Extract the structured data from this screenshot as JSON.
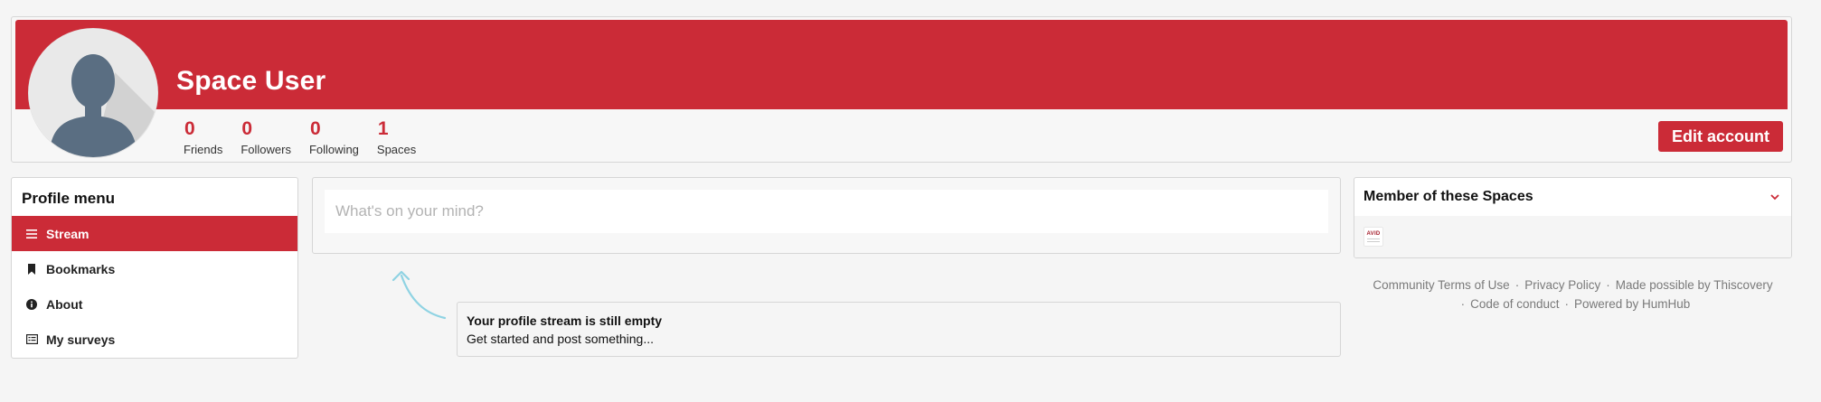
{
  "profile": {
    "name": "Space User",
    "stats": [
      {
        "value": "0",
        "label": "Friends"
      },
      {
        "value": "0",
        "label": "Followers"
      },
      {
        "value": "0",
        "label": "Following"
      },
      {
        "value": "1",
        "label": "Spaces"
      }
    ],
    "edit_label": "Edit account"
  },
  "menu": {
    "title": "Profile menu",
    "items": [
      {
        "label": "Stream",
        "icon": "list-icon",
        "active": true
      },
      {
        "label": "Bookmarks",
        "icon": "bookmark-icon",
        "active": false
      },
      {
        "label": "About",
        "icon": "info-icon",
        "active": false
      },
      {
        "label": "My surveys",
        "icon": "survey-icon",
        "active": false
      }
    ]
  },
  "composer": {
    "placeholder": "What's on your mind?"
  },
  "empty_stream": {
    "title": "Your profile stream is still empty",
    "subtitle": "Get started and post something..."
  },
  "spaces": {
    "title": "Member of these Spaces",
    "logo_text": "AVID"
  },
  "footer": {
    "line1": [
      "Community Terms of Use",
      "Privacy Policy",
      "Made possible by Thiscovery"
    ],
    "line2": [
      "Code of conduct",
      "Powered by HumHub"
    ],
    "separator": "·"
  },
  "colors": {
    "accent": "#cb2b37",
    "background": "#f5f5f5"
  }
}
